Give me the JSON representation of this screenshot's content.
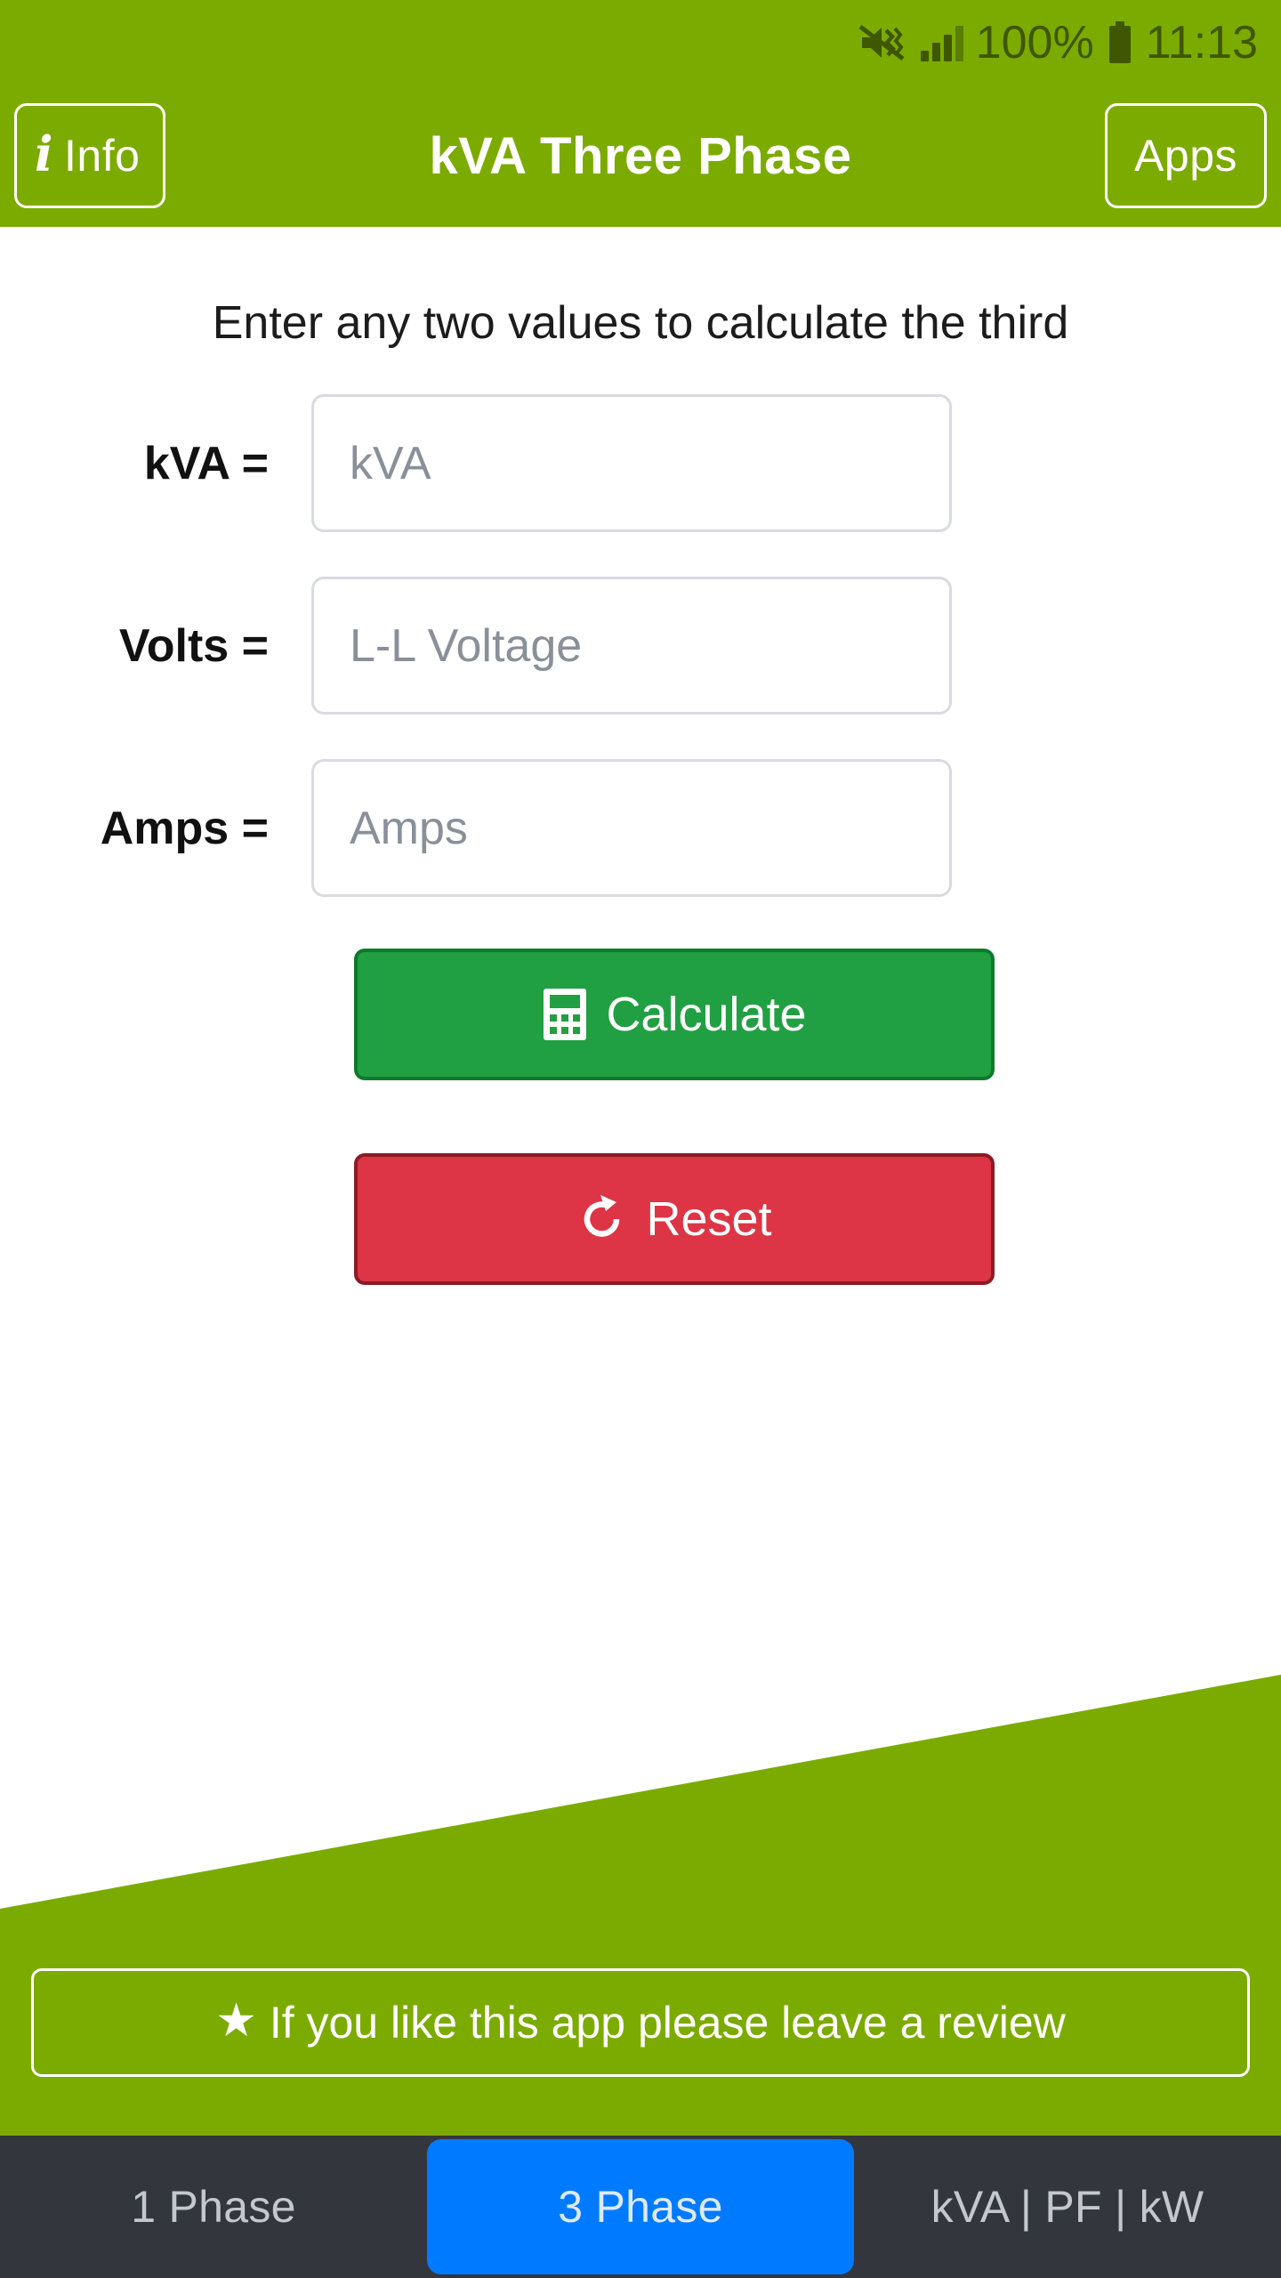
{
  "status_bar": {
    "mute_icon": "mute-vibrate-icon",
    "signal_icon": "signal-bars-icon",
    "battery_percent": "100%",
    "battery_icon": "battery-full-icon",
    "time": "11:13"
  },
  "header": {
    "info_label": "Info",
    "info_icon": "info-icon",
    "title": "kVA Three Phase",
    "apps_label": "Apps"
  },
  "main": {
    "hint": "Enter any two values to calculate the third",
    "fields": [
      {
        "label": "kVA =",
        "placeholder": "kVA",
        "value": ""
      },
      {
        "label": "Volts =",
        "placeholder": "L-L Voltage",
        "value": ""
      },
      {
        "label": "Amps =",
        "placeholder": "Amps",
        "value": ""
      }
    ],
    "calculate_label": "Calculate",
    "calculate_icon": "calculator-icon",
    "reset_label": "Reset",
    "reset_icon": "refresh-icon"
  },
  "review": {
    "star_icon": "star-icon",
    "label": "If you like this app please leave a review"
  },
  "tabs": [
    {
      "label": "1 Phase",
      "active": false
    },
    {
      "label": "3 Phase",
      "active": true
    },
    {
      "label": "kVA | PF | kW",
      "active": false
    }
  ],
  "colors": {
    "brand_green": "#7CAB00",
    "calculate_green": "#21a043",
    "reset_red": "#dd3545",
    "tabbar_dark": "#33363D",
    "active_tab_blue": "#007BFF",
    "status_icon_green": "#3f5700"
  }
}
